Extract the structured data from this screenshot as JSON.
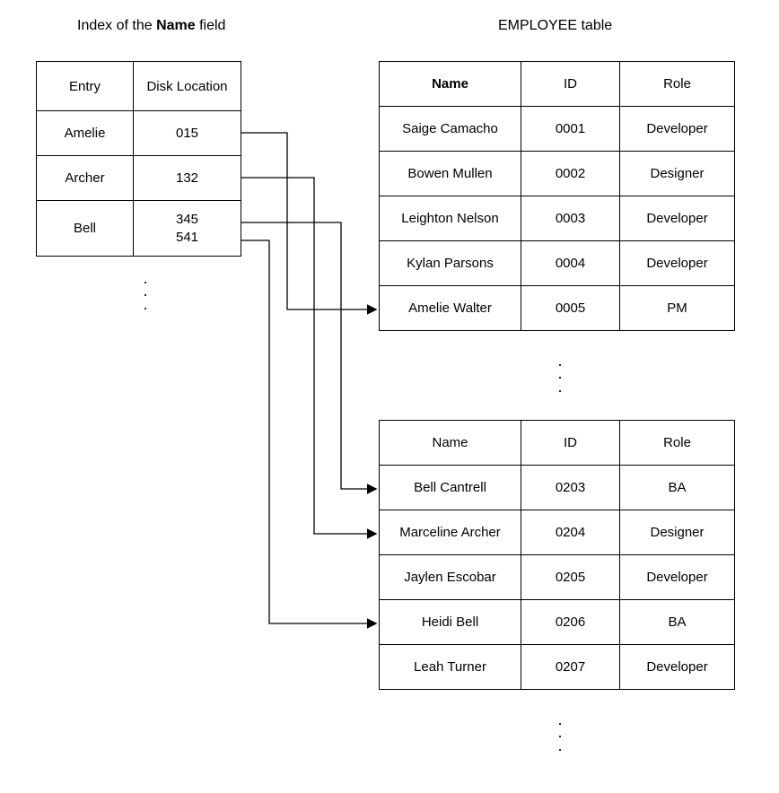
{
  "indexTitle": {
    "pre": "Index of the ",
    "bold": "Name",
    "post": " field"
  },
  "employeeTitle": "EMPLOYEE table",
  "indexTable": {
    "headers": {
      "entry": "Entry",
      "disk": "Disk Location"
    },
    "rows": [
      {
        "entry": "Amelie",
        "disk": "015"
      },
      {
        "entry": "Archer",
        "disk": "132"
      },
      {
        "entry": "Bell",
        "disk1": "345",
        "disk2": "541"
      }
    ]
  },
  "empTable1": {
    "headers": {
      "name": "Name",
      "id": "ID",
      "role": "Role"
    },
    "rows": [
      {
        "name": "Saige Camacho",
        "id": "0001",
        "role": "Developer"
      },
      {
        "name": "Bowen Mullen",
        "id": "0002",
        "role": "Designer"
      },
      {
        "name": "Leighton Nelson",
        "id": "0003",
        "role": "Developer"
      },
      {
        "name": "Kylan Parsons",
        "id": "0004",
        "role": "Developer"
      },
      {
        "name": "Amelie Walter",
        "id": "0005",
        "role": "PM"
      }
    ]
  },
  "empTable2": {
    "headers": {
      "name": "Name",
      "id": "ID",
      "role": "Role"
    },
    "rows": [
      {
        "name": "Bell Cantrell",
        "id": "0203",
        "role": "BA"
      },
      {
        "name": "Marceline Archer",
        "id": "0204",
        "role": "Designer"
      },
      {
        "name": "Jaylen Escobar",
        "id": "0205",
        "role": "Developer"
      },
      {
        "name": "Heidi Bell",
        "id": "0206",
        "role": "BA"
      },
      {
        "name": "Leah Turner",
        "id": "0207",
        "role": "Developer"
      }
    ]
  },
  "dot": "."
}
